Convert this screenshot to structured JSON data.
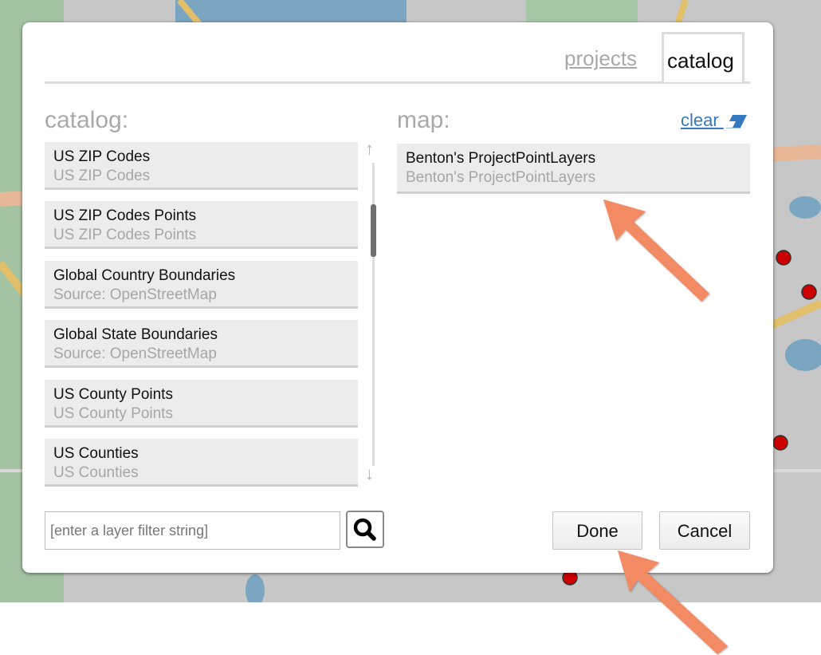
{
  "tabs": [
    {
      "label": "projects",
      "active": false
    },
    {
      "label": "catalog",
      "active": true
    }
  ],
  "catalog": {
    "heading": "catalog:",
    "items": [
      {
        "title": "US ZIP Codes",
        "subtitle": "US ZIP Codes"
      },
      {
        "title": "US ZIP Codes Points",
        "subtitle": "US ZIP Codes Points"
      },
      {
        "title": "Global Country Boundaries",
        "subtitle": "Source: OpenStreetMap"
      },
      {
        "title": "Global State Boundaries",
        "subtitle": "Source: OpenStreetMap"
      },
      {
        "title": "US County Points",
        "subtitle": "US County Points"
      },
      {
        "title": "US Counties",
        "subtitle": "US Counties"
      }
    ],
    "scroll_up_glyph": "↑",
    "scroll_down_glyph": "↓"
  },
  "map": {
    "heading": "map:",
    "clear_label": "clear",
    "items": [
      {
        "title": "Benton's ProjectPointLayers",
        "subtitle": "Benton's ProjectPointLayers"
      }
    ]
  },
  "filter": {
    "placeholder": "[enter a layer filter string]",
    "value": ""
  },
  "buttons": {
    "done": "Done",
    "cancel": "Cancel"
  },
  "icons": {
    "search": "search-icon",
    "eraser": "eraser-icon"
  },
  "colors": {
    "link": "#3579c1",
    "annotation_arrow": "#f28a64",
    "map_point": "#cc0000"
  }
}
